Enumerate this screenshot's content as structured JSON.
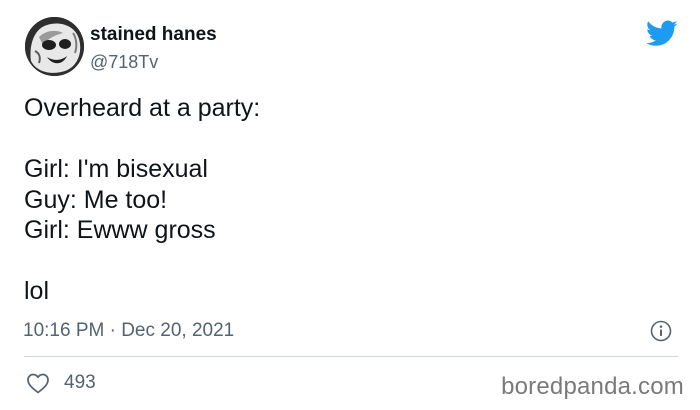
{
  "author": {
    "display_name": "stained hanes",
    "handle": "@718Tv",
    "avatar_icon": "masked-wrestler-avatar"
  },
  "brand": {
    "logo_icon": "twitter-bird-icon",
    "logo_color": "#1d9bf0"
  },
  "tweet": {
    "lines": [
      "Overheard at a party:",
      "",
      "Girl: I'm bisexual",
      "Guy: Me too!",
      "Girl: Ewww gross",
      "",
      "lol"
    ],
    "timestamp": "10:16 PM · Dec 20, 2021"
  },
  "actions": {
    "like_icon": "heart-icon",
    "like_count": "493",
    "info_icon": "info-icon"
  },
  "watermark": {
    "text": "boredpanda.com"
  },
  "colors": {
    "text_primary": "#0f1419",
    "text_secondary": "#536471",
    "divider": "#cfd9de"
  }
}
